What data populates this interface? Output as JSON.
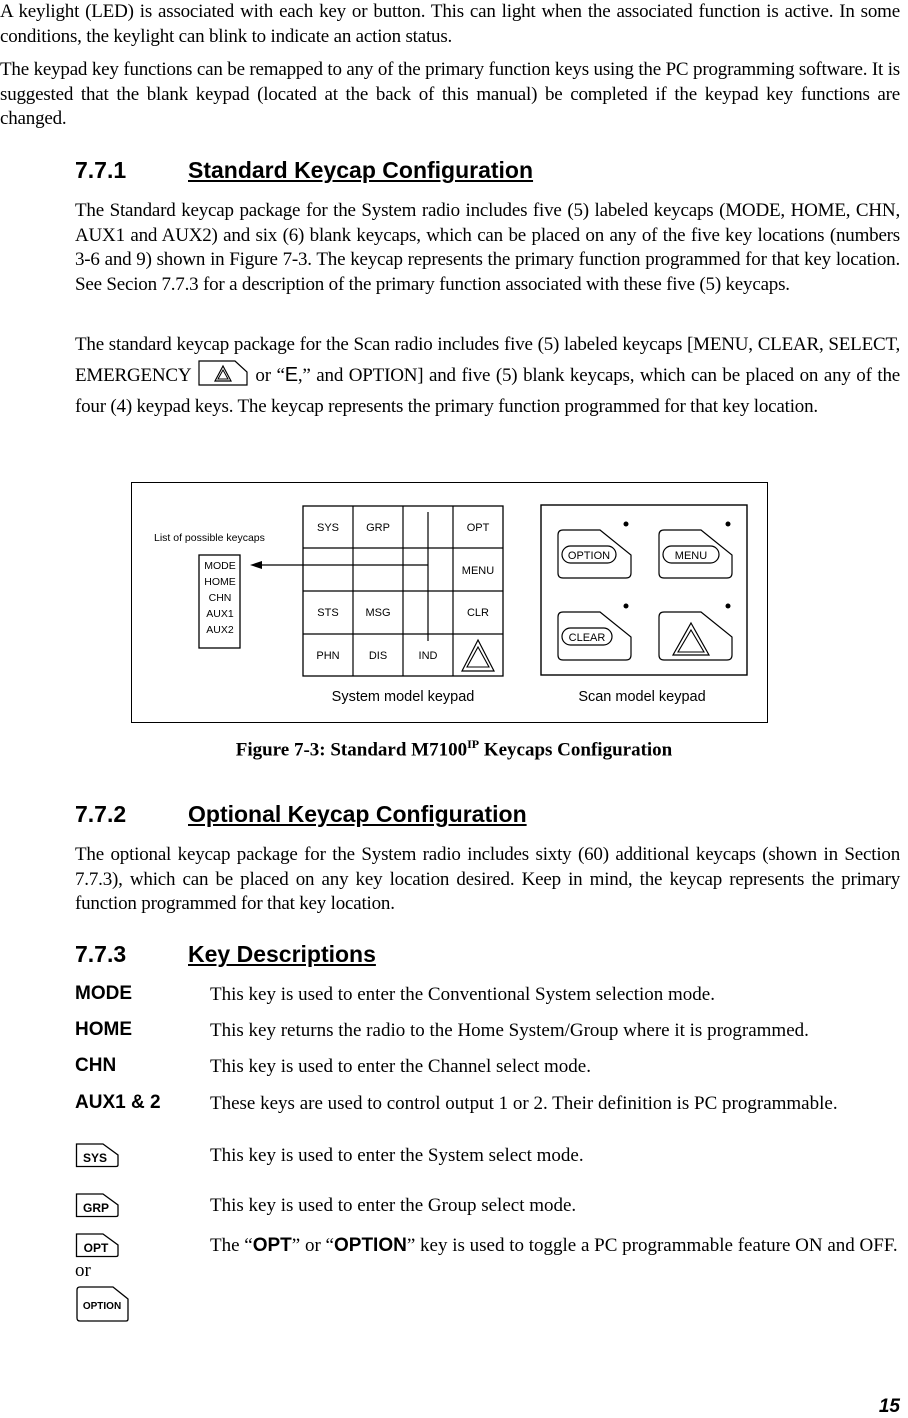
{
  "intro": {
    "p1": "A keylight (LED) is associated with each key or button. This can light when the associated function is active. In some conditions, the keylight can blink to indicate an action status.",
    "p2": "The keypad key functions can be remapped to any of the primary function keys using the PC programming software.  It is suggested that the blank keypad (located at the back of this manual) be completed if the keypad key functions are changed."
  },
  "section_771": {
    "number": "7.7.1",
    "title": "Standard Keycap Configuration",
    "p1": "The Standard keycap package for the System radio includes five (5) labeled keycaps (MODE, HOME, CHN, AUX1 and AUX2) and six (6) blank keycaps, which can be placed on any of the five key locations (numbers 3-6 and 9) shown in Figure 7-3. The keycap represents the primary function programmed for that key location.  See Secion 7.7.3 for a description of the primary function associated with these five (5) keycaps.",
    "p2_before": "The standard keycap package for the Scan radio includes five (5) labeled keycaps [MENU, CLEAR, SELECT, EMERGENCY",
    "p2_or": "or “",
    "p2_e": "E",
    "p2_after": ",” and OPTION] and five (5) blank keycaps, which can be placed on any of the four (4) keypad keys. The keycap represents the primary function programmed for that key location."
  },
  "figure": {
    "list_label": "List of possible keycaps",
    "possible_keycaps": [
      "MODE",
      "HOME",
      "CHN",
      "AUX1",
      "AUX2"
    ],
    "system_keypad": {
      "rows": [
        [
          "SYS",
          "GRP",
          "",
          "OPT"
        ],
        [
          "",
          "",
          "",
          "MENU"
        ],
        [
          "STS",
          "MSG",
          "",
          "CLR"
        ],
        [
          "PHN",
          "DIS",
          "IND",
          "emergency-triangle"
        ]
      ],
      "label": "System model keypad"
    },
    "scan_keypad": {
      "keys": [
        "OPTION",
        "MENU",
        "CLEAR",
        "emergency-triangle"
      ],
      "label": "Scan model keypad"
    },
    "caption_prefix": "Figure 7-3:  Standard M7100",
    "caption_sup": "IP",
    "caption_suffix": " Keycaps Configuration"
  },
  "section_772": {
    "number": "7.7.2",
    "title": "Optional Keycap Configuration",
    "p1": "The optional keycap package for the System radio includes sixty (60) additional keycaps (shown in Section 7.7.3), which can be placed on any key location desired.  Keep in mind, the keycap represents the primary function programmed for that key location."
  },
  "section_773": {
    "number": "7.7.3",
    "title": "Key Descriptions",
    "keys": [
      {
        "key": "MODE",
        "desc": "This key is used to enter the Conventional System selection mode."
      },
      {
        "key": "HOME",
        "desc": "This key returns the radio to the Home System/Group where it is programmed."
      },
      {
        "key": "CHN",
        "desc": "This key is used to enter the Channel select mode."
      },
      {
        "key": "AUX1 & 2",
        "desc": "These keys are used to control output 1 or 2. Their definition is PC programmable."
      }
    ],
    "icon_keys": [
      {
        "icon": "SYS",
        "desc": "This key is used to enter the System select mode."
      },
      {
        "icon": "GRP",
        "desc": "This key is used to enter the Group select mode."
      }
    ],
    "opt": {
      "icon1": "OPT",
      "or": "or",
      "icon2": "OPTION",
      "desc_pre": "The “",
      "desc_b1": "OPT",
      "desc_mid": "” or “",
      "desc_b2": "OPTION",
      "desc_post": "” key is used to toggle a PC programmable feature ON and OFF."
    }
  },
  "page_number": "15"
}
